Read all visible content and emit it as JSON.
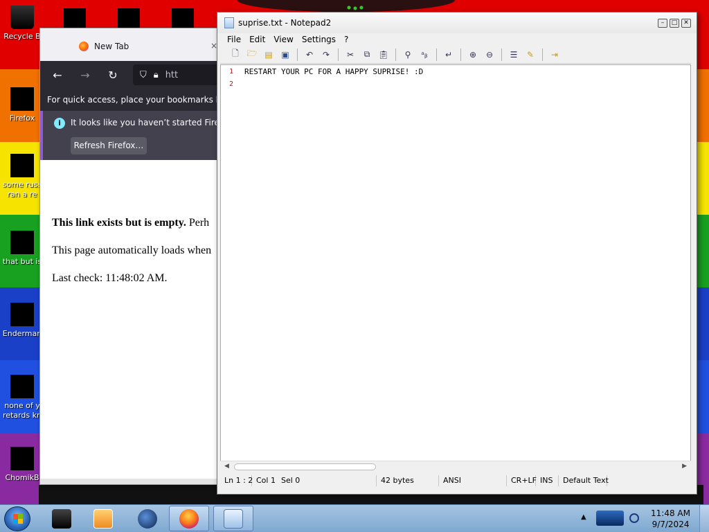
{
  "desktop": {
    "icons": [
      {
        "name": "recycle-bin",
        "label": "Recycle B"
      },
      {
        "name": "firefox",
        "label": "Firefox"
      },
      {
        "name": "some-russ",
        "label": "some russ\nran a re"
      },
      {
        "name": "that-but-is",
        "label": "that but is"
      },
      {
        "name": "enderman",
        "label": "Enderman"
      },
      {
        "name": "none-of-you",
        "label": "none of y\nretards kn"
      },
      {
        "name": "chomikb",
        "label": "ChomikB"
      }
    ]
  },
  "firefox": {
    "tab_title": "New Tab",
    "tab_close": "×",
    "url_partial": "htt",
    "bookmarks_bar_text": "For quick access, place your bookmarks here",
    "notice_text": "It looks like you haven’t started Firefox",
    "refresh_button": "Refresh Firefox…",
    "content": {
      "line1_bold": "This link exists but is empty.",
      "line1_rest": " Perh",
      "line2": "This page automatically loads when",
      "line3": "Last check: 11:48:02 AM."
    }
  },
  "notepad": {
    "title": "suprise.txt - Notepad2",
    "menu": [
      "File",
      "Edit",
      "View",
      "Settings",
      "?"
    ],
    "line_numbers": [
      "1",
      "2"
    ],
    "lines": [
      "RESTART YOUR PC FOR A HAPPY SUPRISE! :D",
      ""
    ],
    "status": {
      "position": "Ln 1 : 2",
      "col": "Col 1",
      "sel": "Sel 0",
      "size": "42 bytes",
      "encoding": "ANSI",
      "eol": "CR+LF",
      "mode": "INS",
      "scheme": "Default Text"
    }
  },
  "taskbar": {
    "clock_time": "11:48 AM",
    "clock_date": "9/7/2024",
    "tray_arrow": "▲"
  },
  "colors": {
    "firefox_dark": "#2b2a33",
    "notice_accent": "#8d5cd5",
    "line_number": "#d01010",
    "taskbar": "#8fb4dc"
  }
}
